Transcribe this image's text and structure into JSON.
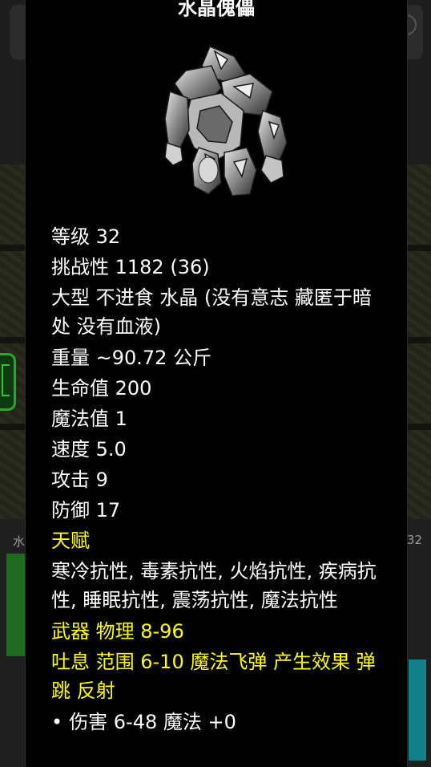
{
  "background": {
    "left_label": "水",
    "right_label": "32"
  },
  "monster": {
    "name": "水晶傀儡",
    "portrait_icon": "crystal-golem-portrait",
    "stats": {
      "level": "等级 32",
      "challenge": "挑战性 1182 (36)",
      "traits": "大型 不进食 水晶 (没有意志 藏匿于暗处 没有血液)",
      "weight": "重量 ~90.72 公斤",
      "hp": "生命值 200",
      "mp": "魔法值 1",
      "speed": "速度 5.0",
      "attack": "攻击 9",
      "defense": "防御 17"
    },
    "talents_header": "天赋",
    "talents": "寒冷抗性, 毒素抗性, 火焰抗性, 疾病抗性, 睡眠抗性, 震荡抗性, 魔法抗性",
    "weapon": "武器 物理 8-96",
    "breath": "吐息 范围 6-10 魔法飞弹 产生效果 弹跳 反射",
    "bullet_symbol": "•",
    "damage": "伤害 6-48 魔法 +0"
  },
  "colors": {
    "panel_bg": "#000000",
    "text": "#ffffff",
    "highlight": "#ffff00"
  }
}
